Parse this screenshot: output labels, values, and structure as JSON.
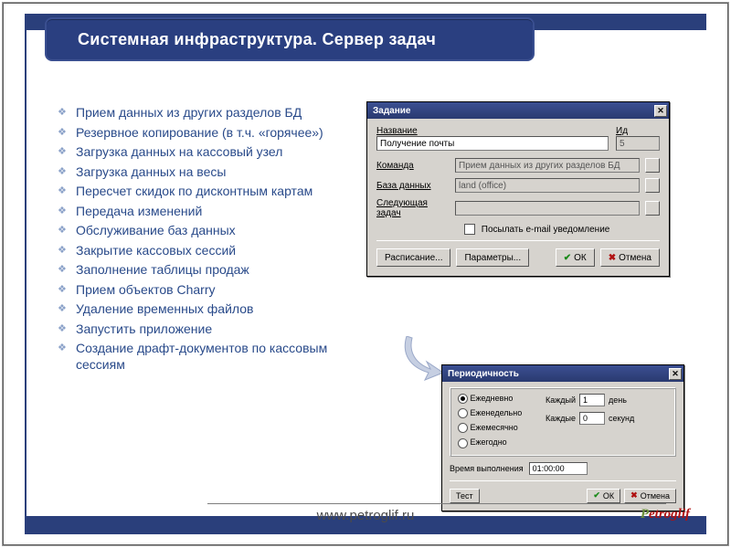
{
  "slide": {
    "title": "Системная инфраструктура. Сервер задач",
    "bullets": [
      "Прием данных из других разделов БД",
      "Резервное копирование (в т.ч. «горячее»)",
      "Загрузка данных на кассовый узел",
      "Загрузка данных на весы",
      "Пересчет скидок по дисконтным картам",
      "Передача изменений",
      "Обслуживание баз данных",
      "Закрытие кассовых сессий",
      "Заполнение таблицы продаж",
      "Прием объектов Charry",
      "Удаление временных файлов",
      "Запустить приложение",
      "Создание драфт-документов по кассовым сессиям"
    ]
  },
  "dlg1": {
    "title": "Задание",
    "labels": {
      "name": "Название",
      "id": "Ид",
      "cmd": "Команда",
      "db": "База данных",
      "next": "Следующая задач",
      "email_chk": "Посылать e-mail уведомление",
      "sched": "Расписание...",
      "params": "Параметры...",
      "ok": "ОК",
      "cancel": "Отмена"
    },
    "values": {
      "name": "Получение почты",
      "id": "5",
      "cmd": "Прием данных из других разделов БД",
      "db": "land (office)"
    }
  },
  "dlg2": {
    "title": "Периодичность",
    "labels": {
      "daily": "Ежедневно",
      "weekly": "Еженедельно",
      "monthly": "Ежемесячно",
      "yearly": "Ежегодно",
      "every": "Каждый",
      "unit_day": "день",
      "every_sec": "Каждые",
      "unit_sec": "секунд",
      "runtime": "Время выполнения",
      "test": "Тест",
      "ok": "ОК",
      "cancel": "Отмена"
    },
    "values": {
      "every_day": "1",
      "every_sec": "0",
      "runtime": "01:00:00"
    }
  },
  "footer": {
    "url": "www.petroglif.ru",
    "logo": "Petroglif"
  }
}
